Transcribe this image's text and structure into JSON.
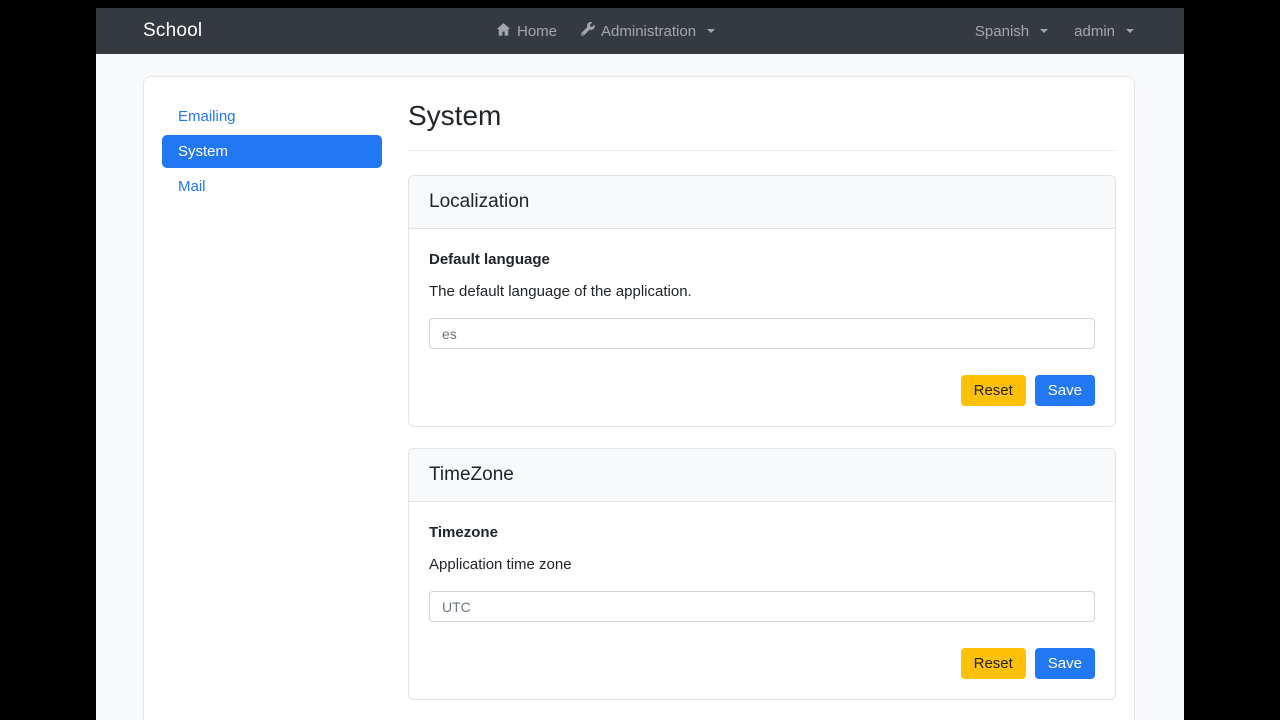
{
  "navbar": {
    "brand": "School",
    "home_label": "Home",
    "admin_label": "Administration",
    "language_label": "Spanish",
    "user_label": "admin"
  },
  "sidebar": {
    "items": [
      {
        "label": "Emailing",
        "active": false
      },
      {
        "label": "System",
        "active": true
      },
      {
        "label": "Mail",
        "active": false
      }
    ]
  },
  "page": {
    "title": "System"
  },
  "cards": [
    {
      "title": "Localization",
      "field_label": "Default language",
      "field_desc": "The default language of the application.",
      "input_value": "es",
      "reset_label": "Reset",
      "save_label": "Save"
    },
    {
      "title": "TimeZone",
      "field_label": "Timezone",
      "field_desc": "Application time zone",
      "input_value": "UTC",
      "reset_label": "Reset",
      "save_label": "Save"
    }
  ],
  "colors": {
    "primary": "#2277f2",
    "warning": "#ffc107",
    "navbar_bg": "#343a40",
    "page_bg": "#f8f9fa"
  }
}
